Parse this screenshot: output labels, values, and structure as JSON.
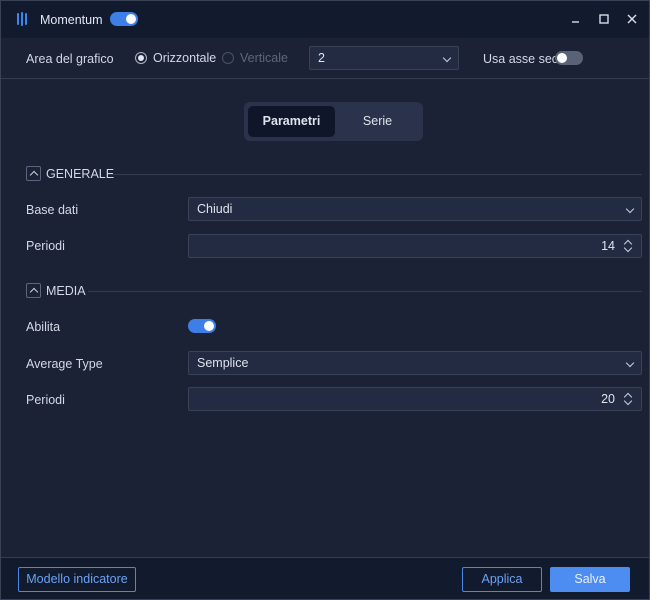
{
  "titlebar": {
    "title": "Momentum",
    "enabled": true,
    "icons": {
      "app": "bars-icon",
      "minimize": "minimize-icon",
      "maximize": "maximize-icon",
      "close": "close-icon"
    }
  },
  "chart_area": {
    "label": "Area del grafico",
    "orientation_options": [
      {
        "label": "Orizzontale",
        "selected": true,
        "disabled": false
      },
      {
        "label": "Verticale",
        "selected": false,
        "disabled": true
      }
    ],
    "pane_value": "2",
    "secondary_axis_label": "Usa asse sec.",
    "secondary_axis_enabled": false
  },
  "tabs": [
    {
      "label": "Parametri",
      "active": true
    },
    {
      "label": "Serie",
      "active": false
    }
  ],
  "sections": {
    "general": {
      "title": "GENERALE",
      "base_label": "Base dati",
      "base_value": "Chiudi",
      "period_label": "Periodi",
      "period_value": "14"
    },
    "average": {
      "title": "MEDIA",
      "enable_label": "Abilita",
      "enabled": true,
      "type_label": "Average Type",
      "type_value": "Semplice",
      "period_label": "Periodi",
      "period_value": "20"
    }
  },
  "footer": {
    "template_label": "Modello indicatore",
    "apply_label": "Applica",
    "save_label": "Salva"
  },
  "colors": {
    "background": "#1b2236",
    "titlebar": "#121a2e",
    "accent": "#3d7fe6",
    "primary_button": "#4d8cf0"
  }
}
